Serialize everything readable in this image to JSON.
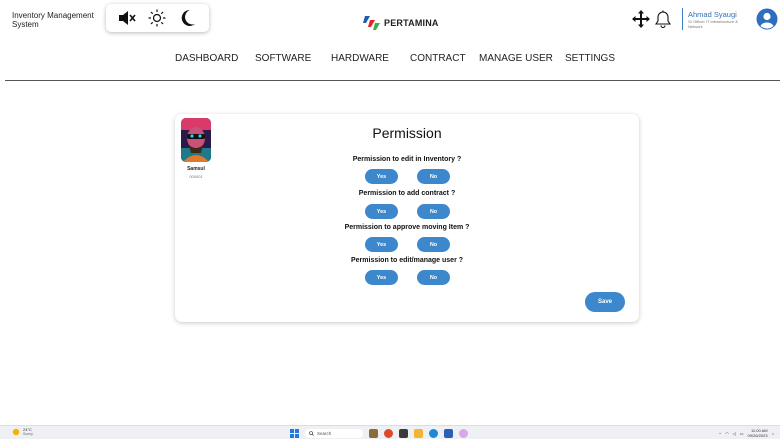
{
  "app": {
    "title": "Inventory Management System",
    "brand": "PERTAMINA"
  },
  "header": {
    "icons": [
      "mute-icon",
      "sun-icon",
      "moon-icon",
      "move-icon",
      "bell-icon",
      "user-avatar-icon"
    ],
    "user": {
      "name": "Ahmad Syaugi",
      "role": "Sr Officer IT Infrastructure & Network"
    }
  },
  "nav": {
    "items": [
      "DASHBOARD",
      "SOFTWARE",
      "HARDWARE",
      "CONTRACT",
      "MANAGE USER",
      "SETTINGS"
    ]
  },
  "card": {
    "title": "Permission",
    "profile": {
      "name": "Samsul",
      "id": "000001"
    },
    "questions": [
      {
        "label": "Permission to edit in Inventory ?",
        "yes": "Yes",
        "no": "No"
      },
      {
        "label": "Permission to add contract ?",
        "yes": "Yes",
        "no": "No"
      },
      {
        "label": "Permission to approve moving Item ?",
        "yes": "Yes",
        "no": "No"
      },
      {
        "label": "Permission to edit/manage user ?",
        "yes": "Yes",
        "no": "No"
      }
    ],
    "save_label": "Save"
  },
  "taskbar": {
    "weather": {
      "temp": "24°C",
      "condition": "Sunny"
    },
    "search_label": "Search",
    "clock": {
      "time": "11:00 AM",
      "date": "09/26/2023"
    }
  },
  "colors": {
    "accent": "#3d87cd",
    "user_name": "#2e6fbd",
    "brand_red": "#e0262b",
    "brand_blue": "#1b5fae",
    "brand_green": "#3fae49"
  }
}
